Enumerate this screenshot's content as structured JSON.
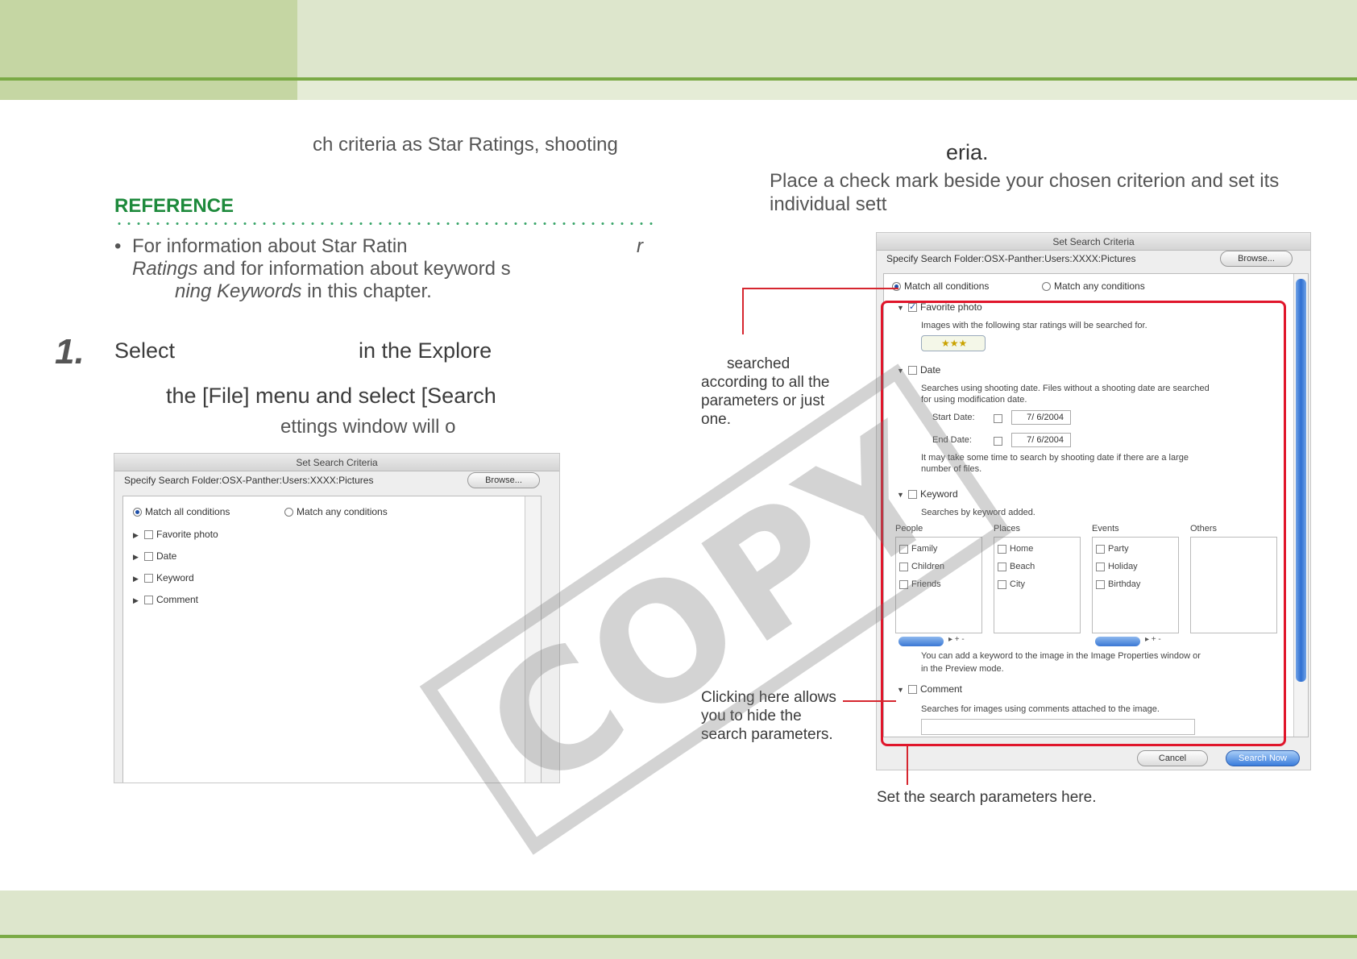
{
  "intro": {
    "fragment": "ch criteria as Star Ratings, shooting"
  },
  "reference": {
    "title": "REFERENCE",
    "bullet": "•",
    "line1": "For information about Star Ratin",
    "line1_tail": "r",
    "line2_italic": "Ratings",
    "line2_rest": "and for information about keyword s",
    "line3_italic": "ning Keywords",
    "line3_rest": "in this chapter."
  },
  "step": {
    "number": "1.",
    "line1_a": "Select",
    "line1_b": "in the Explore",
    "line2": "the [File] menu and select [Search",
    "line3": "ettings window will o"
  },
  "right": {
    "heading": "eria.",
    "para_line1": "Place a check mark beside your chosen criterion and set its",
    "para_line2": "individual sett"
  },
  "annotations": {
    "match": [
      "searched",
      "according to all the",
      "parameters or just",
      "one."
    ],
    "hide": [
      "Clicking here allows",
      "you to hide the",
      "search parameters."
    ],
    "set": "Set the search parameters here."
  },
  "dialog_small": {
    "title": "Set Search Criteria",
    "folder": "Specify Search Folder:OSX-Panther:Users:XXXX:Pictures",
    "browse": "Browse...",
    "match_all": "Match all conditions",
    "match_any": "Match any conditions",
    "items": [
      "Favorite photo",
      "Date",
      "Keyword",
      "Comment"
    ]
  },
  "dialog_large": {
    "title": "Set Search Criteria",
    "folder": "Specify Search Folder:OSX-Panther:Users:XXXX:Pictures",
    "browse": "Browse...",
    "match_all": "Match all conditions",
    "match_any": "Match any conditions",
    "favorite": "Favorite photo",
    "favorite_desc": "Images with the following star ratings will be searched for.",
    "stars": "★★★",
    "date": "Date",
    "date_desc1": "Searches using shooting date. Files without a shooting date are searched",
    "date_desc2": "for using modification date.",
    "start_date_label": "Start Date:",
    "start_date": "7/ 6/2004",
    "end_date_label": "End Date:",
    "end_date": "7/ 6/2004",
    "date_note1": "It may take some time to search by shooting date if there are a large",
    "date_note2": "number of files.",
    "keyword": "Keyword",
    "keyword_desc": "Searches by keyword added.",
    "columns": [
      {
        "name": "People",
        "items": [
          "Family",
          "Children",
          "Friends"
        ]
      },
      {
        "name": "Places",
        "items": [
          "Home",
          "Beach",
          "City"
        ]
      },
      {
        "name": "Events",
        "items": [
          "Party",
          "Holiday",
          "Birthday"
        ]
      },
      {
        "name": "Others",
        "items": []
      }
    ],
    "kw_note1": "You can add a keyword to the image in the Image Properties window or",
    "kw_note2": "in the Preview mode.",
    "comment": "Comment",
    "comment_desc": "Searches for images using comments attached to the image.",
    "cancel": "Cancel",
    "search_now": "Search Now"
  },
  "watermark": "COPY",
  "colors": {
    "band": "#dde6cc",
    "tab": "#c5d6a3",
    "rule": "#7aaa45",
    "reference": "#1e8a3c",
    "callout": "#e0162b"
  }
}
